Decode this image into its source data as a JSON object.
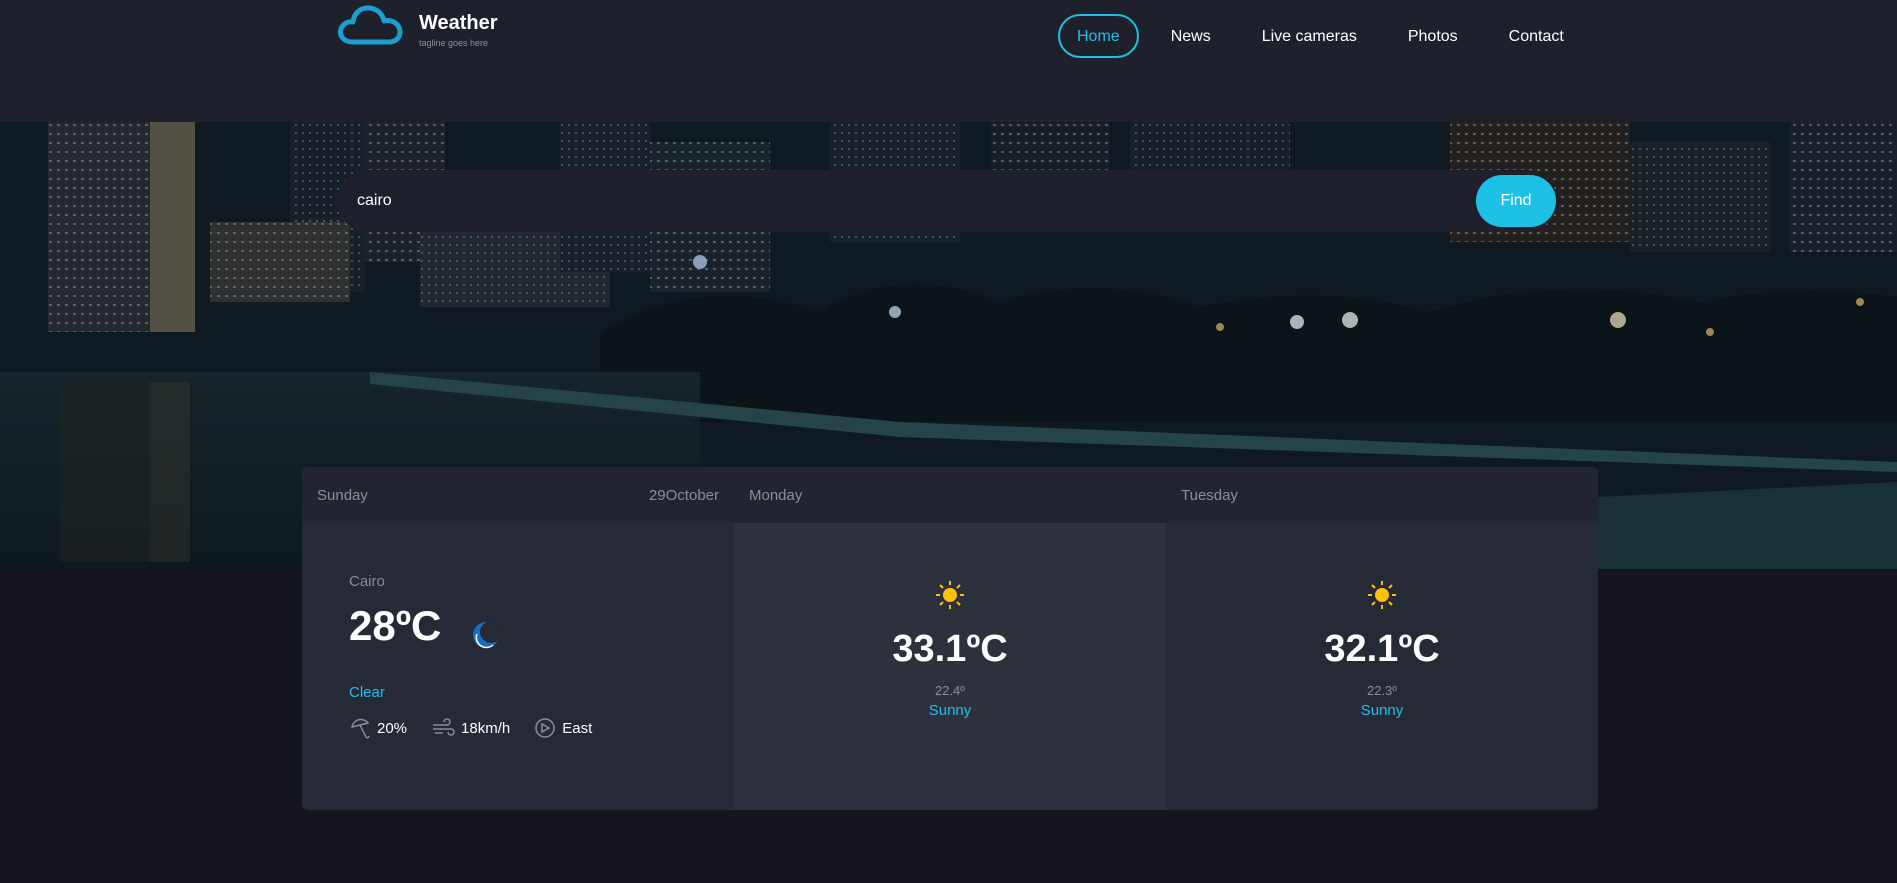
{
  "header": {
    "site_title": "Weather",
    "tagline": "tagline goes here",
    "nav": [
      {
        "label": "Home",
        "active": true
      },
      {
        "label": "News"
      },
      {
        "label": "Live cameras"
      },
      {
        "label": "Photos"
      },
      {
        "label": "Contact"
      }
    ]
  },
  "search": {
    "value": "cairo",
    "button_label": "Find"
  },
  "today": {
    "day": "Sunday",
    "date": "29October",
    "city": "Cairo",
    "temperature": "28ºC",
    "icon": "moon-icon",
    "condition": "Clear",
    "humidity": "20%",
    "wind_speed": "18km/h",
    "wind_direction": "East"
  },
  "forecast": [
    {
      "day": "Monday",
      "icon": "sun-icon",
      "temperature": "33.1ºC",
      "low": "22.4º",
      "condition": "Sunny"
    },
    {
      "day": "Tuesday",
      "icon": "sun-icon",
      "temperature": "32.1ºC",
      "low": "22.3º",
      "condition": "Sunny"
    }
  ],
  "colors": {
    "accent": "#1ec1e6",
    "header_bg": "#1e202b",
    "page_bg": "#14151d",
    "sun": "#ffc107"
  }
}
